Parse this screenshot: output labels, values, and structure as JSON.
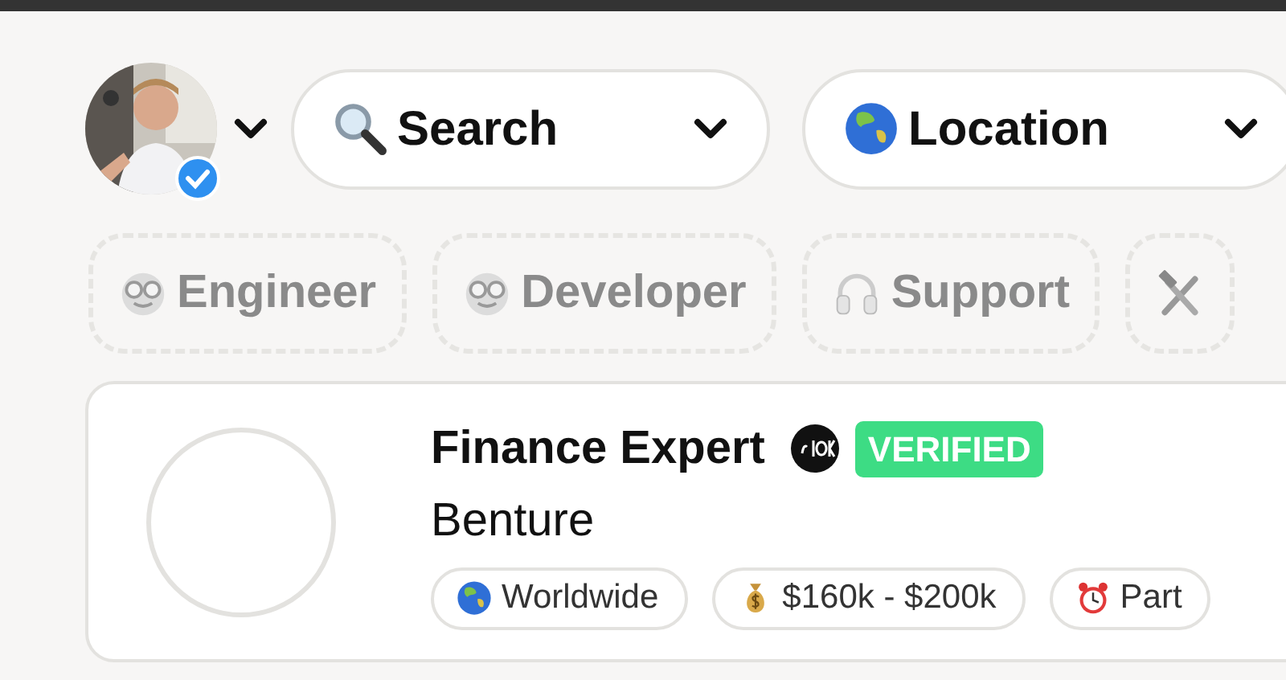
{
  "header": {
    "account_menu": {
      "verified": true
    },
    "filters": [
      {
        "kind": "search",
        "label": "Search"
      },
      {
        "kind": "location",
        "label": "Location"
      }
    ]
  },
  "categories": [
    {
      "kind": "nerd",
      "label": "Engineer"
    },
    {
      "kind": "nerd",
      "label": "Developer"
    },
    {
      "kind": "headphones",
      "label": "Support"
    },
    {
      "kind": "tools"
    }
  ],
  "job": {
    "title": "Finance Expert",
    "badge": "VERIFIED",
    "company": "Benture",
    "tags": [
      {
        "kind": "globe",
        "label": "Worldwide"
      },
      {
        "kind": "money",
        "label": "$160k - $200k"
      },
      {
        "kind": "clock",
        "label": "Part"
      }
    ]
  }
}
